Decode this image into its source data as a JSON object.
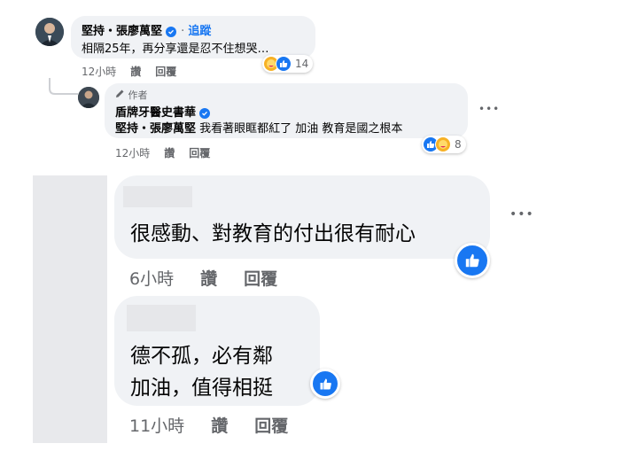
{
  "comment1": {
    "author": "堅持・張廖萬堅",
    "follow_label": "追蹤",
    "text": "相隔25年，再分享還是忍不住想哭…",
    "reaction_count": "14",
    "time": "12小時",
    "like_label": "讚",
    "reply_label": "回覆"
  },
  "reply1": {
    "author_badge": "作者",
    "author": "盾牌牙醫史書華",
    "mention": "堅持・張廖萬堅",
    "text": "我看著眼眶都紅了 加油 教育是國之根本",
    "reaction_count": "8",
    "time": "12小時",
    "like_label": "讚",
    "reply_label": "回覆",
    "more": "•••"
  },
  "comment2": {
    "text": "很感動、對教育的付出很有耐心",
    "time": "6小時",
    "like_label": "讚",
    "reply_label": "回覆",
    "more": "•••"
  },
  "comment3": {
    "line1": "德不孤，必有鄰",
    "line2": "加油，值得相挺",
    "time": "11小時",
    "like_label": "讚",
    "reply_label": "回覆"
  },
  "colors": {
    "accent": "#1877f2",
    "bubble": "#f0f2f5",
    "meta": "#65676b"
  }
}
